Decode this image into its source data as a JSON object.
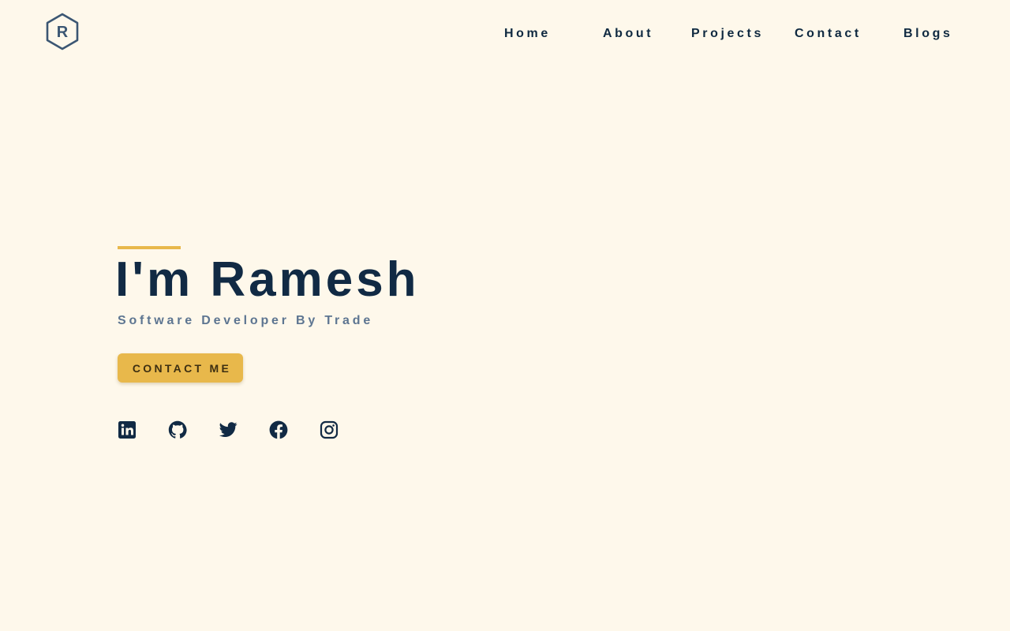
{
  "brand": {
    "logo_letter": "R",
    "logo_icon": "hexagon-r-logo"
  },
  "nav": {
    "items": [
      {
        "label": "Home"
      },
      {
        "label": "About"
      },
      {
        "label": "Projects"
      },
      {
        "label": "Contact"
      },
      {
        "label": "Blogs"
      }
    ]
  },
  "hero": {
    "title": "I'm Ramesh",
    "subtitle": "Software Developer By Trade",
    "cta_label": "CONTACT ME"
  },
  "socials": [
    {
      "icon": "linkedin-icon"
    },
    {
      "icon": "github-icon"
    },
    {
      "icon": "twitter-icon"
    },
    {
      "icon": "facebook-icon"
    },
    {
      "icon": "instagram-icon"
    }
  ],
  "colors": {
    "background": "#fef8eb",
    "primary_text": "#112a44",
    "secondary_text": "#5d7591",
    "accent": "#e8b84b",
    "logo": "#3b5673"
  }
}
